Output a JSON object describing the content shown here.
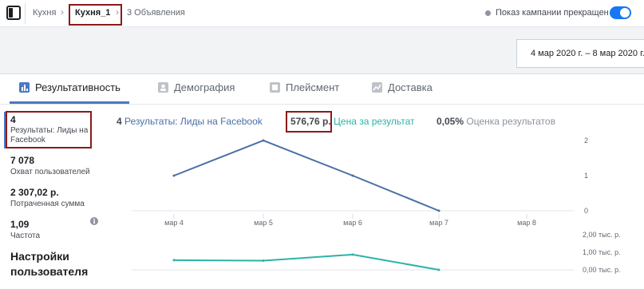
{
  "breadcrumb": {
    "campaign": "Кухня",
    "adset": "Кухня_1",
    "ads": "3 Объявления"
  },
  "status": {
    "label": "Показ кампании прекращен",
    "toggle_on": true
  },
  "date_range": "4 мар 2020 г. – 8 мар 2020 г.",
  "tabs": [
    {
      "label": "Результативность",
      "icon": "bar-chart-icon",
      "active": true
    },
    {
      "label": "Демография",
      "icon": "people-icon",
      "active": false
    },
    {
      "label": "Плейсмент",
      "icon": "placement-icon",
      "active": false
    },
    {
      "label": "Доставка",
      "icon": "delivery-chart-icon",
      "active": false
    }
  ],
  "metrics": [
    {
      "value": "4",
      "label": "Результаты: Лиды на Facebook"
    },
    {
      "value": "7 078",
      "label": "Охват пользователей"
    },
    {
      "value": "2 307,02 р.",
      "label": "Потраченная сумма"
    },
    {
      "value": "1,09",
      "label": "Частота"
    }
  ],
  "settings_title": "Настройки пользователя",
  "legend": [
    {
      "value": "4",
      "label": "Результаты: Лиды на Facebook",
      "color": "#4a6fa5"
    },
    {
      "value": "576,76 р.",
      "label": "Цена за результат",
      "color": "#2bb3a8"
    },
    {
      "value": "0,05%",
      "label": "Оценка результатов",
      "color": "#8d949e"
    }
  ],
  "colors": {
    "accent": "#1877f2",
    "results_line": "#4a6fa5",
    "cost_line": "#2bb3a8",
    "highlight_box": "#8b1a1a"
  },
  "chart_data": [
    {
      "type": "line",
      "categories": [
        "мар 4",
        "мар 5",
        "мар 6",
        "мар 7",
        "мар 8"
      ],
      "series": [
        {
          "name": "Результаты: Лиды на Facebook",
          "values": [
            1,
            2,
            1,
            0,
            null
          ]
        }
      ],
      "yticks": [
        "0",
        "1",
        "2"
      ],
      "ylim": [
        0,
        2
      ],
      "grid": true
    },
    {
      "type": "line",
      "categories": [
        "мар 4",
        "мар 5",
        "мар 6",
        "мар 7",
        "мар 8"
      ],
      "series": [
        {
          "name": "Цена за результат",
          "values": [
            550,
            520,
            870,
            0,
            null
          ]
        }
      ],
      "yticks": [
        "0,00 тыс. р.",
        "1,00 тыс. р.",
        "2,00 тыс. р."
      ],
      "ylim": [
        0,
        2000
      ]
    }
  ]
}
